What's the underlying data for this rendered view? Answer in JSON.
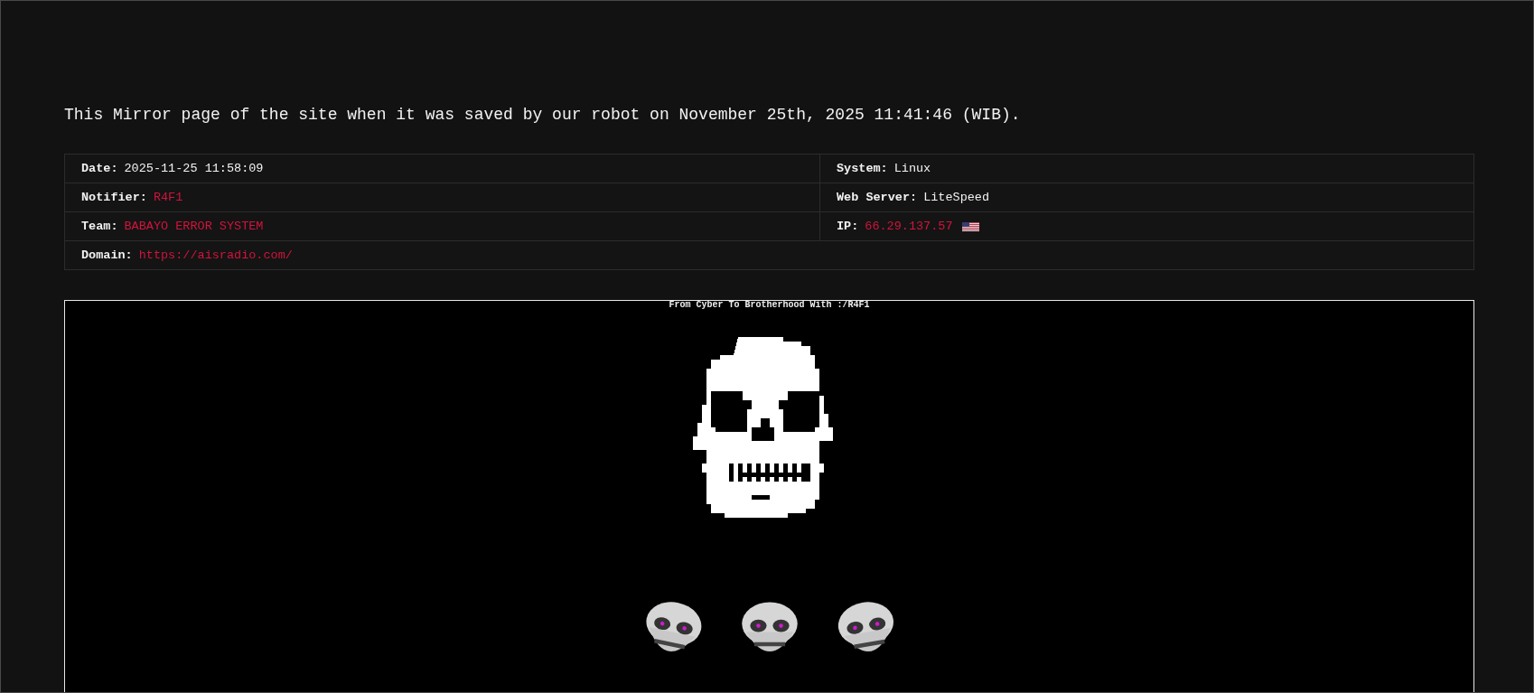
{
  "notice": "This Mirror page of the site when it was saved by our robot on November 25th, 2025 11:41:46 (WIB).",
  "info_rows": [
    {
      "left": {
        "label": "Date:",
        "value": "2025-11-25 11:58:09",
        "highlighted": false
      },
      "right": {
        "label": "System:",
        "value": "Linux",
        "highlighted": false
      }
    },
    {
      "left": {
        "label": "Notifier:",
        "value": "R4F1",
        "highlighted": true
      },
      "right": {
        "label": "Web Server:",
        "value": "LiteSpeed",
        "highlighted": false
      }
    },
    {
      "left": {
        "label": "Team:",
        "value": "BABAYO ERROR SYSTEM",
        "highlighted": true
      },
      "right": {
        "label": "IP:",
        "value": "66.29.137.57",
        "highlighted": true,
        "flag": true
      }
    },
    {
      "left": {
        "label": "Domain:",
        "value": "https://aisradio.com/",
        "highlighted": true
      }
    }
  ],
  "mirror": {
    "caption": "From Cyber To Brotherhood With :/R4F1"
  }
}
